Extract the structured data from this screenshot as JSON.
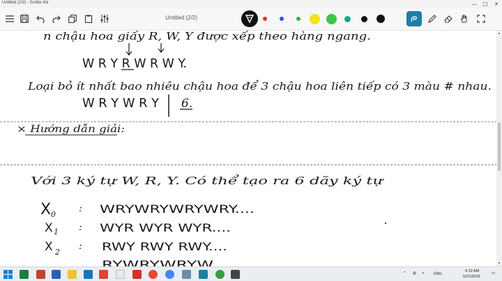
{
  "window": {
    "title": "Untitled (2/2) - Scrble Ink",
    "minimize_glyph": "—",
    "maximize_glyph": "□",
    "close_glyph": "✕"
  },
  "toolbar": {
    "doc_title": "Untitled (2/2)",
    "pen_colors": [
      "#e03030",
      "#2d57c8",
      "#35b335",
      "#f3e11c",
      "#3ac64c",
      "#1aa58d",
      "#111111"
    ],
    "accent": "#1c7fa6"
  },
  "notes": {
    "line1": "n chậu hoa giấy R, W, Y được xếp theo hàng ngang.",
    "line2": "W R Y R W R W Y.",
    "line3": "Loại bỏ ít nhất bao nhiêu chậu hoa để 3 chậu hoa liên tiếp có 3 màu # nhau.",
    "line4": "W R Y W R Y",
    "line4_answer": "6.",
    "line5": "× Hướng dẫn giải:",
    "line6": "Với 3 ký tự W, R, Y. Có thể tạo ra 6 dãy ký tự",
    "x0_label": "X",
    "x0_sub": "0",
    "x0_value": "WRYWRYWRYWRY....",
    "x1_label": "X",
    "x1_sub": "1",
    "x1_value": "WYR WYR WYR....",
    "x2_label": "X",
    "x2_sub": "2",
    "x2_value": "RWY RWY RWY....",
    "x3_value": "RYWRYWRYW...",
    "colon": ":",
    "annot_r": "R",
    "annot_w": "W",
    "annot_y": "Y"
  },
  "taskbar": {
    "time": "9:13 AM",
    "date": "5/21/2023",
    "lang": "ENG"
  }
}
